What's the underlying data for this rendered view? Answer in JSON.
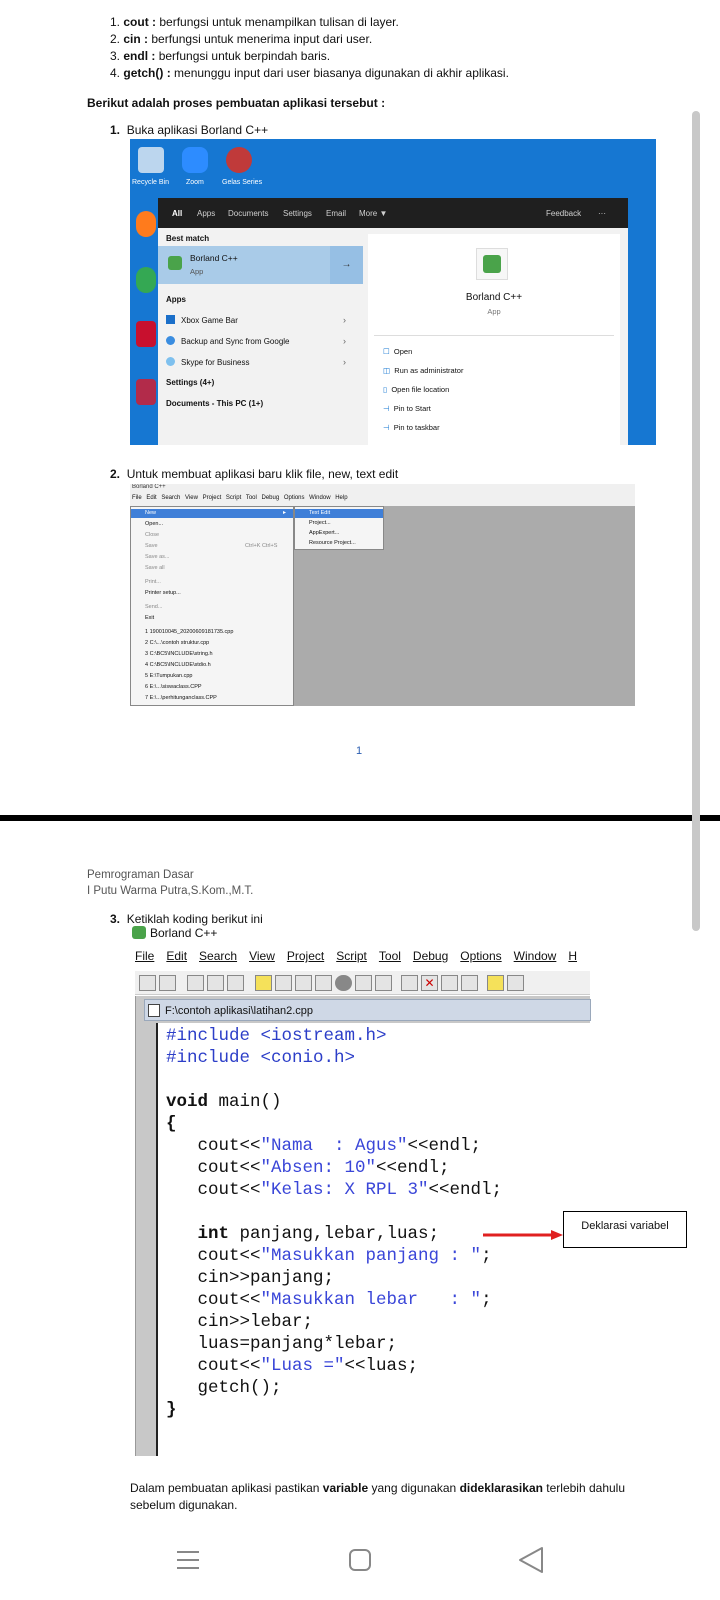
{
  "top_list": [
    {
      "num": "1.",
      "term": "cout :",
      "desc": " berfungsi untuk menampilkan tulisan di layer."
    },
    {
      "num": "2.",
      "term": "cin :",
      "desc": " berfungsi untuk menerima input dari user."
    },
    {
      "num": "3.",
      "term": "endl :",
      "desc": " berfungsi untuk berpindah baris."
    },
    {
      "num": "4.",
      "term": "getch() :",
      "desc": " menunggu input dari user biasanya digunakan di akhir aplikasi."
    }
  ],
  "process_heading": "Berikut adalah proses pembuatan aplikasi tersebut :",
  "step1": {
    "num": "1.",
    "text": "Buka aplikasi Borland C++"
  },
  "startmenu": {
    "desktop_icons": [
      "Recycle Bin",
      "Zoom",
      "Gelas Series"
    ],
    "tabs": [
      "All",
      "Apps",
      "Documents",
      "Settings",
      "Email",
      "More ▼"
    ],
    "feedback": "Feedback",
    "more_dots": "···",
    "best_match_label": "Best match",
    "best_match_name": "Borland C++",
    "best_match_type": "App",
    "apps_label": "Apps",
    "apps": [
      "Xbox Game Bar",
      "Backup and Sync from Google",
      "Skype for Business"
    ],
    "settings_label": "Settings (4+)",
    "documents_label": "Documents - This PC (1+)",
    "detail_name": "Borland C++",
    "detail_type": "App",
    "actions": [
      "Open",
      "Run as administrator",
      "Open file location",
      "Pin to Start",
      "Pin to taskbar"
    ]
  },
  "step2": {
    "num": "2.",
    "text": "Untuk membuat aplikasi baru klik file, new, text edit"
  },
  "borland_menu": {
    "title": "Borland C++",
    "menubar": "File Edit Search View Project Script Tool Debug Options Window Help",
    "file_items": [
      "New",
      "Open...",
      "Close",
      "Save",
      "Save as...",
      "Save all",
      "Print...",
      "Printer setup...",
      "Send...",
      "Exit"
    ],
    "save_shortcut": "Ctrl+K Ctrl+S",
    "recent": [
      "1 190010045_20200609181735.cpp",
      "2 C:\\...\\contoh struktur.cpp",
      "3 C:\\BC5\\INCLUDE\\string.h",
      "4 C:\\BC5\\INCLUDE\\stdio.h",
      "5 E:\\Tumpukan.cpp",
      "6 E:\\...\\siswaclass.CPP",
      "7 E:\\...\\perhitunganclass.CPP"
    ],
    "new_submenu": [
      "Text Edit",
      "Project...",
      "AppExpert...",
      "Resource Project..."
    ]
  },
  "page_number": "1",
  "header_line1": "Pemrograman Dasar",
  "header_line2": "I Putu Warma Putra,S.Kom.,M.T.",
  "step3": {
    "num": "3.",
    "text": "Ketiklah koding berikut ini"
  },
  "ide": {
    "title": "Borland C++",
    "menu": [
      "File",
      "Edit",
      "Search",
      "View",
      "Project",
      "Script",
      "Tool",
      "Debug",
      "Options",
      "Window",
      "H"
    ],
    "file_path": "F:\\contoh aplikasi\\latihan2.cpp"
  },
  "code_lines": [
    "#include <iostream.h>",
    "#include <conio.h>",
    "",
    "void main()",
    "{",
    "   cout<<\"Nama  : Agus\"<<endl;",
    "   cout<<\"Absen: 10\"<<endl;",
    "   cout<<\"Kelas: X RPL 3\"<<endl;",
    "",
    "   int panjang,lebar,luas;",
    "   cout<<\"Masukkan panjang : \";",
    "   cin>>panjang;",
    "   cout<<\"Masukkan lebar   : \";",
    "   cin>>lebar;",
    "   luas=panjang*lebar;",
    "   cout<<\"Luas =\"<<luas;",
    "   getch();",
    "}"
  ],
  "callout": "Deklarasi variabel",
  "note": {
    "part1": "Dalam pembuatan aplikasi pastikan ",
    "bold1": "variable",
    "part2": " yang digunakan ",
    "bold2": "dideklarasikan",
    "part3": " terlebih dahulu sebelum digunakan."
  },
  "colors": {
    "accent_blue": "#1677d2",
    "code_string": "#3a46d8",
    "arrow_red": "#e02020"
  }
}
